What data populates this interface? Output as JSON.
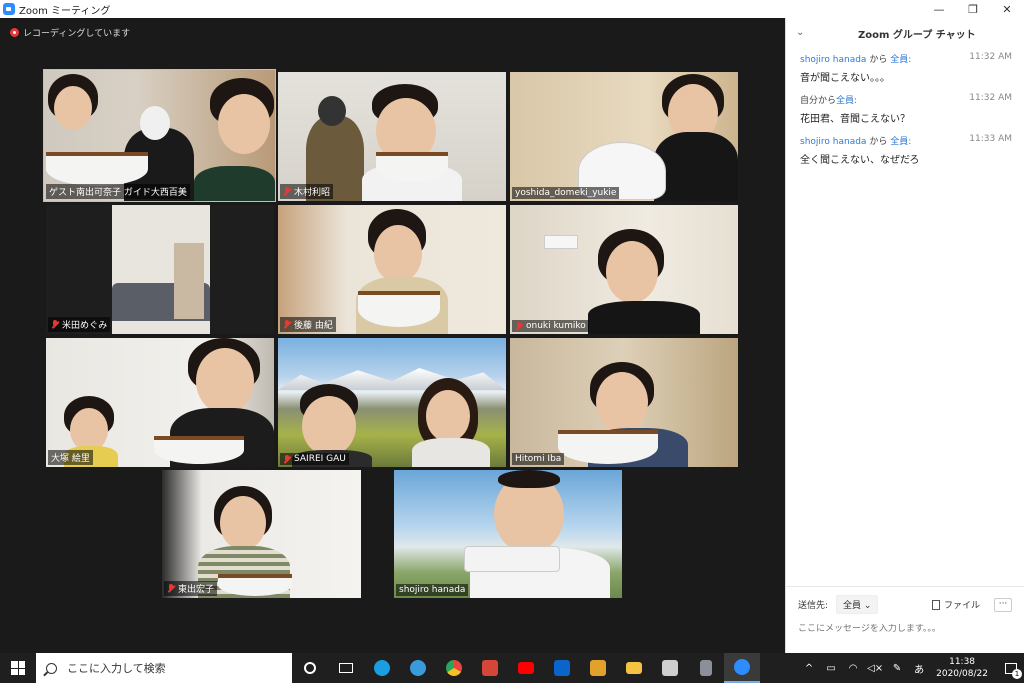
{
  "window": {
    "title": "Zoom ミーティング",
    "minimize": "—",
    "restore": "❐",
    "close": "✕"
  },
  "recording": {
    "label": "レコーディングしています"
  },
  "participants": [
    {
      "name": "ゲスト南出可奈子 ガイド大西百美",
      "muted": false
    },
    {
      "name": "木村利昭",
      "muted": true
    },
    {
      "name": "yoshida_domeki_yukie",
      "muted": false
    },
    {
      "name": "米田めぐみ",
      "muted": true
    },
    {
      "name": "後藤 由紀",
      "muted": true
    },
    {
      "name": "onuki kumiko",
      "muted": true
    },
    {
      "name": "大塚 絵里",
      "muted": false
    },
    {
      "name": "SAIREI GAU",
      "muted": true
    },
    {
      "name": "Hitomi Iba",
      "muted": false
    },
    {
      "name": "東出宏子",
      "muted": true
    },
    {
      "name": "shojiro hanada",
      "muted": false
    }
  ],
  "chat": {
    "title": "Zoom グループ チャット",
    "collapse_icon": "⌄",
    "messages": [
      {
        "sender": "shojiro hanada",
        "connector": "から",
        "recipient": "全員",
        "time": "11:32 AM",
        "text": "音が聞こえない。。。"
      },
      {
        "sender": "自分から",
        "connector": "",
        "recipient": "全員",
        "time": "11:32 AM",
        "text": "花田君、音聞こえない？"
      },
      {
        "sender": "shojiro hanada",
        "connector": "から",
        "recipient": "全員",
        "time": "11:33 AM",
        "text": "全く聞こえない、なぜだろ"
      }
    ],
    "to_label": "送信先:",
    "to_value": "全員",
    "file_label": "ファイル",
    "more_label": "···",
    "input_placeholder": "ここにメッセージを入力します。。。"
  },
  "taskbar": {
    "search_placeholder": "ここに入力して検索",
    "time": "11:38",
    "date": "2020/08/22",
    "ime": "あ",
    "notification_count": "1",
    "colors": {
      "edge": "#1b9de2",
      "ie": "#3a9bdc",
      "chrome": "#e8453c",
      "gmail": "#d44638",
      "youtube": "#ff0000",
      "outlook": "#0a64c9",
      "media": "#e0a22b",
      "explorer": "#f5c242",
      "store": "#cfcfcf",
      "calculator": "#8a8f99",
      "zoom": "#2d8cff"
    }
  }
}
